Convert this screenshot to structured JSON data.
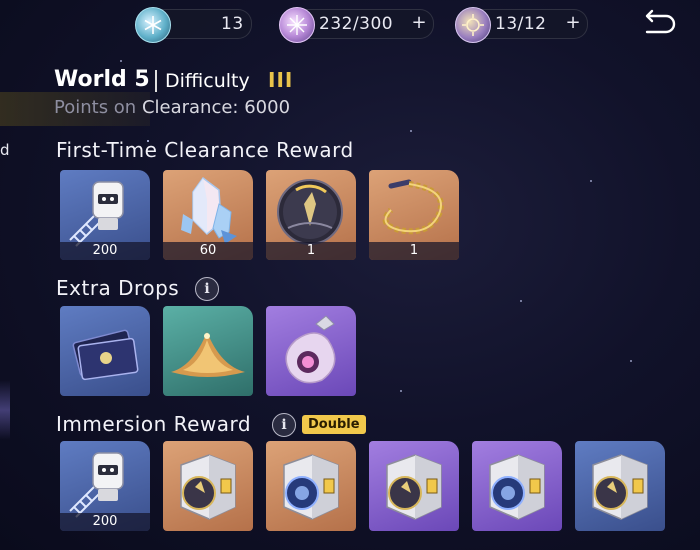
{
  "currencies": [
    {
      "icon": "snowflake-crystal-icon",
      "value": "13"
    },
    {
      "icon": "energy-orb-icon",
      "value": "232/300"
    },
    {
      "icon": "gear-medal-icon",
      "value": "13/12"
    }
  ],
  "side": {
    "cut_label": "d"
  },
  "header": {
    "world": "World 5",
    "difficulty_label": "Difficulty",
    "difficulty_level": "III",
    "points_prefix": "Points on",
    "points_text": "Clearance: 6000"
  },
  "sections": {
    "first_time": "First-Time Clearance Reward",
    "extra_drops": "Extra Drops",
    "immersion": "Immersion Reward",
    "double_badge": "Double"
  },
  "info_glyph": "i",
  "first_time_rewards": [
    {
      "item": "film-robot-item",
      "count": "200"
    },
    {
      "item": "crystal-item",
      "count": "60"
    },
    {
      "item": "dark-orb-item",
      "count": "1"
    },
    {
      "item": "gold-ring-item",
      "count": "1"
    }
  ],
  "extra_drops": [
    {
      "item": "card-pack-item"
    },
    {
      "item": "sand-pile-item"
    },
    {
      "item": "potion-pouch-item"
    }
  ],
  "immersion_rewards": [
    {
      "item": "film-robot-item",
      "count": "200"
    },
    {
      "item": "relic-box-gold-item"
    },
    {
      "item": "relic-box-blue-item"
    },
    {
      "item": "relic-box-gold-item"
    },
    {
      "item": "relic-box-blue-item"
    },
    {
      "item": "relic-box-gold-item"
    }
  ],
  "colors": {
    "accent_gold": "#e8c34a",
    "badge": "#f1c84b"
  }
}
